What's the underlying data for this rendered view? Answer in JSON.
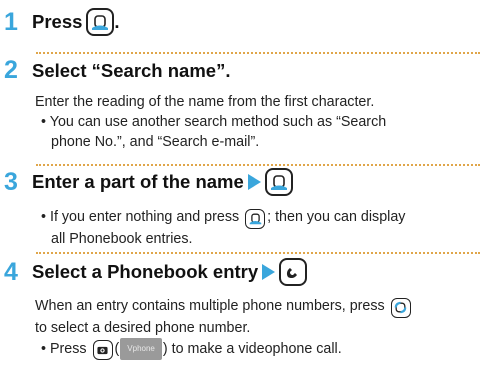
{
  "steps": [
    {
      "number": "1",
      "title": "Press",
      "title_suffix": ".",
      "key_icon": "search-key"
    },
    {
      "number": "2",
      "title": "Select “Search name”.",
      "text": "Enter the reading of the name from the first character.",
      "bullet_line1": "• You can use another search method such as “Search",
      "bullet_line2": "phone No.”, and “Search e-mail”."
    },
    {
      "number": "3",
      "title": "Enter a part of the name",
      "key_icon": "search-key",
      "bullet_before": "• If you enter nothing and press",
      "bullet_after": "; then you can display",
      "bullet_line2": "all Phonebook entries."
    },
    {
      "number": "4",
      "title": "Select a Phonebook entry",
      "key_icon": "call-key",
      "text_line1": "When an entry contains multiple phone numbers, press",
      "text_line2": "to select a desired phone number.",
      "bullet_before": "• Press",
      "soft_key_label": "Vphone",
      "bullet_after": ") to make a videophone call."
    }
  ],
  "colors": {
    "accent": "#3aa6dc",
    "divider": "#e0a64a",
    "key_fill": "#3aa6dc"
  }
}
